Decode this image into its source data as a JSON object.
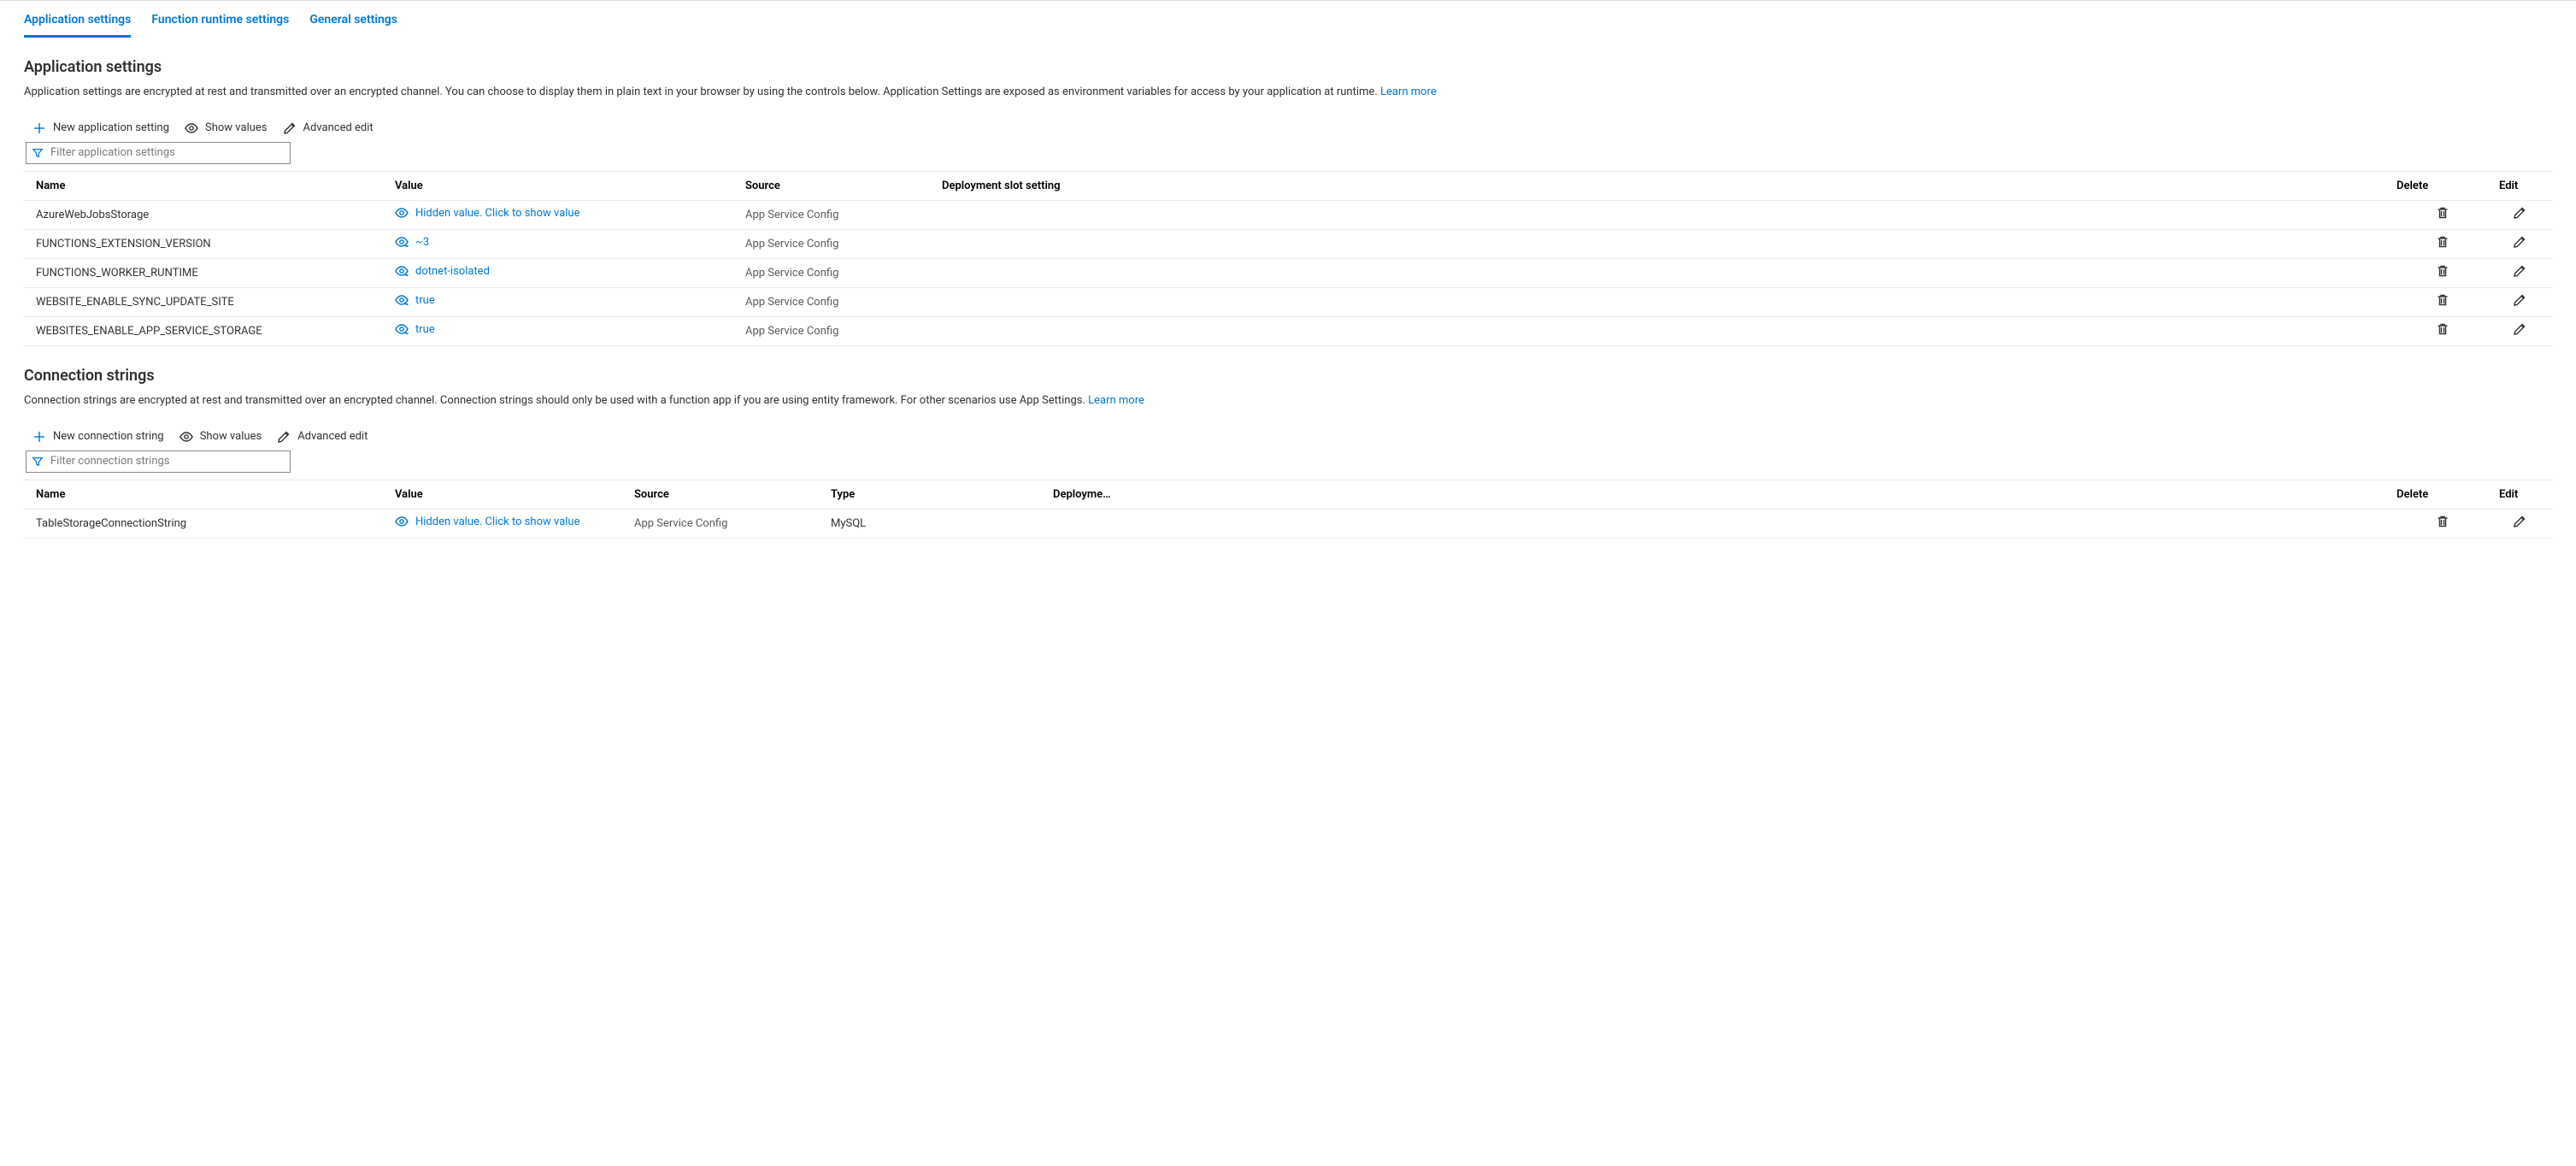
{
  "tabs": [
    {
      "label": "Application settings",
      "active": true
    },
    {
      "label": "Function runtime settings",
      "active": false
    },
    {
      "label": "General settings",
      "active": false
    }
  ],
  "appSettings": {
    "title": "Application settings",
    "description": "Application settings are encrypted at rest and transmitted over an encrypted channel. You can choose to display them in plain text in your browser by using the controls below. Application Settings are exposed as environment variables for access by your application at runtime. ",
    "learnMore": "Learn more",
    "toolbar": {
      "newLabel": "New application setting",
      "showValues": "Show values",
      "advancedEdit": "Advanced edit"
    },
    "filterPlaceholder": "Filter application settings",
    "columns": {
      "name": "Name",
      "value": "Value",
      "source": "Source",
      "slot": "Deployment slot setting",
      "delete": "Delete",
      "edit": "Edit"
    },
    "hiddenValueText": "Hidden value. Click to show value",
    "rows": [
      {
        "name": "AzureWebJobsStorage",
        "valueVisible": false,
        "value": "",
        "source": "App Service Config"
      },
      {
        "name": "FUNCTIONS_EXTENSION_VERSION",
        "valueVisible": true,
        "value": "~3",
        "source": "App Service Config"
      },
      {
        "name": "FUNCTIONS_WORKER_RUNTIME",
        "valueVisible": true,
        "value": "dotnet-isolated",
        "source": "App Service Config"
      },
      {
        "name": "WEBSITE_ENABLE_SYNC_UPDATE_SITE",
        "valueVisible": true,
        "value": "true",
        "source": "App Service Config"
      },
      {
        "name": "WEBSITES_ENABLE_APP_SERVICE_STORAGE",
        "valueVisible": true,
        "value": "true",
        "source": "App Service Config"
      }
    ]
  },
  "connStrings": {
    "title": "Connection strings",
    "description": "Connection strings are encrypted at rest and transmitted over an encrypted channel. Connection strings should only be used with a function app if you are using entity framework. For other scenarios use App Settings. ",
    "learnMore": "Learn more",
    "toolbar": {
      "newLabel": "New connection string",
      "showValues": "Show values",
      "advancedEdit": "Advanced edit"
    },
    "filterPlaceholder": "Filter connection strings",
    "columns": {
      "name": "Name",
      "value": "Value",
      "source": "Source",
      "type": "Type",
      "slot": "Deployme…",
      "delete": "Delete",
      "edit": "Edit"
    },
    "hiddenValueText": "Hidden value. Click to show value",
    "rows": [
      {
        "name": "TableStorageConnectionString",
        "valueVisible": false,
        "value": "",
        "source": "App Service Config",
        "type": "MySQL"
      }
    ]
  }
}
